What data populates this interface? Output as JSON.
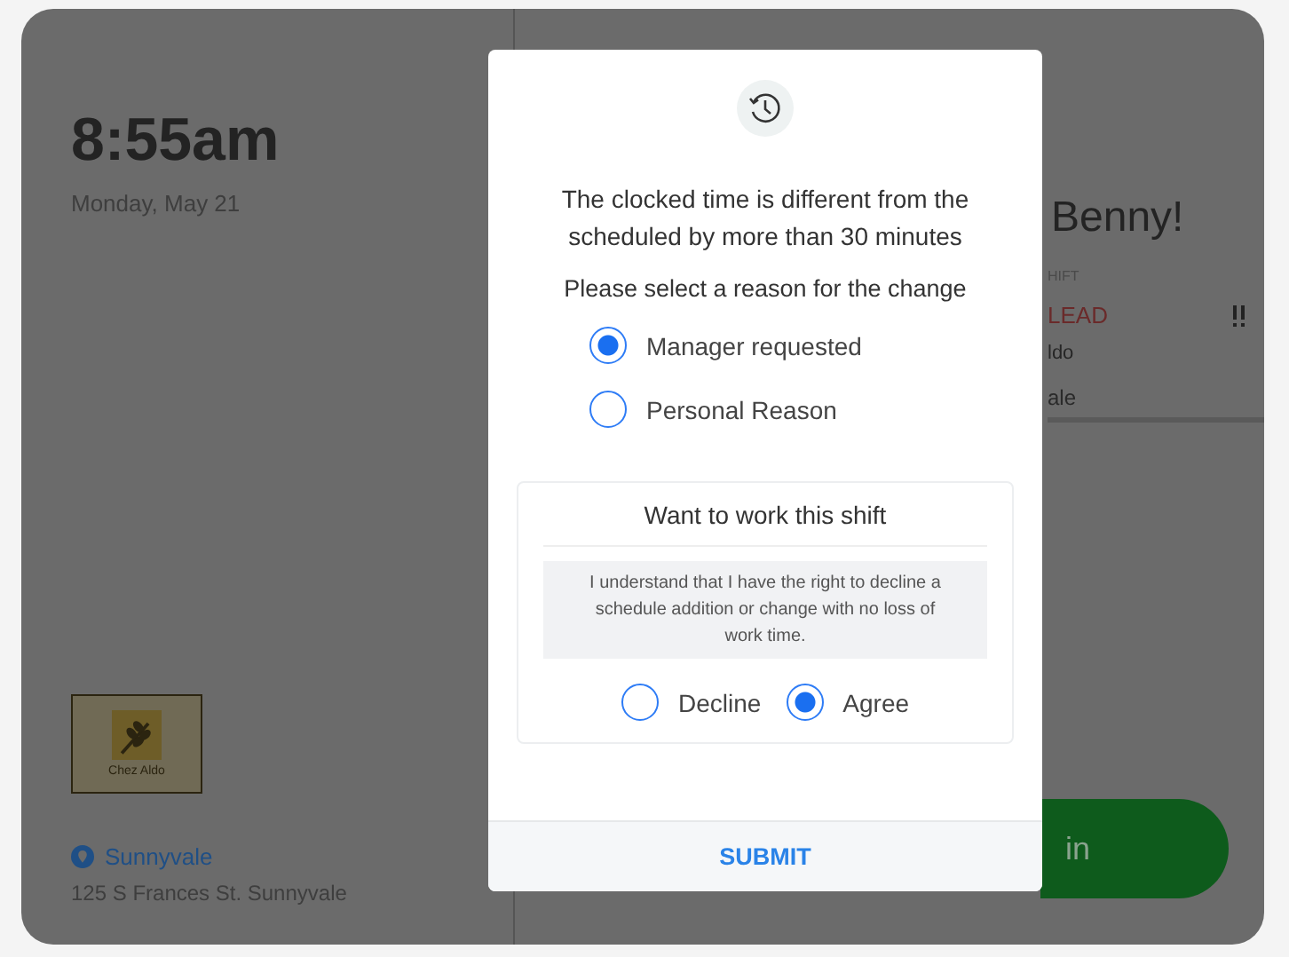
{
  "background": {
    "time": "8:55am",
    "date": "Monday, May 21",
    "logo_text": "Chez Aldo",
    "location": {
      "name": "Sunnyvale",
      "address": "125 S Frances St. Sunnyvale"
    },
    "greeting": "Benny!",
    "shift_label": "HIFT",
    "role": "LEAD",
    "detail": "ldo",
    "store": "ale",
    "clock_button": "in"
  },
  "dialog": {
    "message": "The clocked time is different from the scheduled by more than 30 minutes",
    "prompt": "Please select a reason for the change",
    "reasons": [
      {
        "label": "Manager requested",
        "selected": true
      },
      {
        "label": "Personal Reason",
        "selected": false
      }
    ],
    "consent": {
      "title": "Want to work this shift",
      "notice": "I understand that I have the right to decline a schedule addition or change with no loss of work time.",
      "options": [
        {
          "label": "Decline",
          "selected": false
        },
        {
          "label": "Agree",
          "selected": true
        }
      ]
    },
    "submit": "SUBMIT"
  }
}
